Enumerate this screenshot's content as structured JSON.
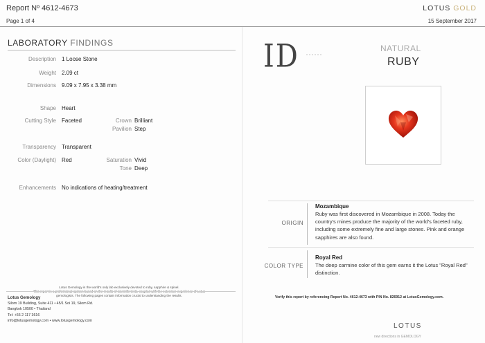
{
  "header": {
    "report_label": "Report Nº 4612-4673",
    "page_label": "Page 1 of 4",
    "brand_main": "LOTUS",
    "brand_accent": "GOLD",
    "date": "15 September 2017"
  },
  "lab": {
    "title_main": "LABORATORY",
    "title_light": "FINDINGS",
    "fields": {
      "description_label": "Description",
      "description_value": "1 Loose Stone",
      "weight_label": "Weight",
      "weight_value": "2.09 ct",
      "dimensions_label": "Dimensions",
      "dimensions_value": "9.09 x 7.95 x 3.38 mm",
      "shape_label": "Shape",
      "shape_value": "Heart",
      "cutting_label": "Cutting Style",
      "cutting_value": "Faceted",
      "crown_label": "Crown",
      "crown_value": "Brilliant",
      "pavilion_label": "Pavilion",
      "pavilion_value": "Step",
      "transparency_label": "Transparency",
      "transparency_value": "Transparent",
      "color_label": "Color (Daylight)",
      "color_value": "Red",
      "saturation_label": "Saturation",
      "saturation_value": "Vivid",
      "tone_label": "Tone",
      "tone_value": "Deep",
      "enhancements_label": "Enhancements",
      "enhancements_value": "No indications of heating/treatment"
    }
  },
  "disclaimer": {
    "line1": "Lotus Gemology is the world's only lab exclusively devoted to ruby, sapphire & spinel.",
    "line2": "This report is a professional opinion based on the results of scientific tests, coupled with the extensive experience of Lotus",
    "line3": "gemologists. The following pages contain information crucial to understanding the results."
  },
  "address": {
    "name": "Lotus Gemology",
    "line1": "Silom 19 Building, Suite 411  •  45/1 Soi 19, Silom Rd.",
    "line2": "Bangkok 10500  •  Thailand",
    "line3": "Tel: +66 2 117 3616",
    "line4": "info@lotusgemology.com  •  www.lotusgemology.com"
  },
  "right": {
    "id_mark": "ID",
    "natural": "NATURAL",
    "ruby": "RUBY",
    "origin_label": "ORIGIN",
    "origin_title": "Mozambique",
    "origin_text": "Ruby was first discovered in Mozambique in 2008. Today the country's mines produce the majority of the world's faceted ruby, including some extremely fine and large stones. Pink and orange sapphires are also found.",
    "colortype_label": "COLOR TYPE",
    "colortype_title": "Royal Red",
    "colortype_text": "The deep carmine color of this gem earns it the Lotus \"Royal Red\" distinction.",
    "verify": "Verify this report by referencing Report No. 4612-4673 with PIN No. 826912 at LotusGemology.com.",
    "logo": "LOTUS",
    "logo_sub": "new directions in GEMOLOGY"
  },
  "colors": {
    "accent_gold": "#c9b27a",
    "ruby_red": "#d62a18"
  }
}
